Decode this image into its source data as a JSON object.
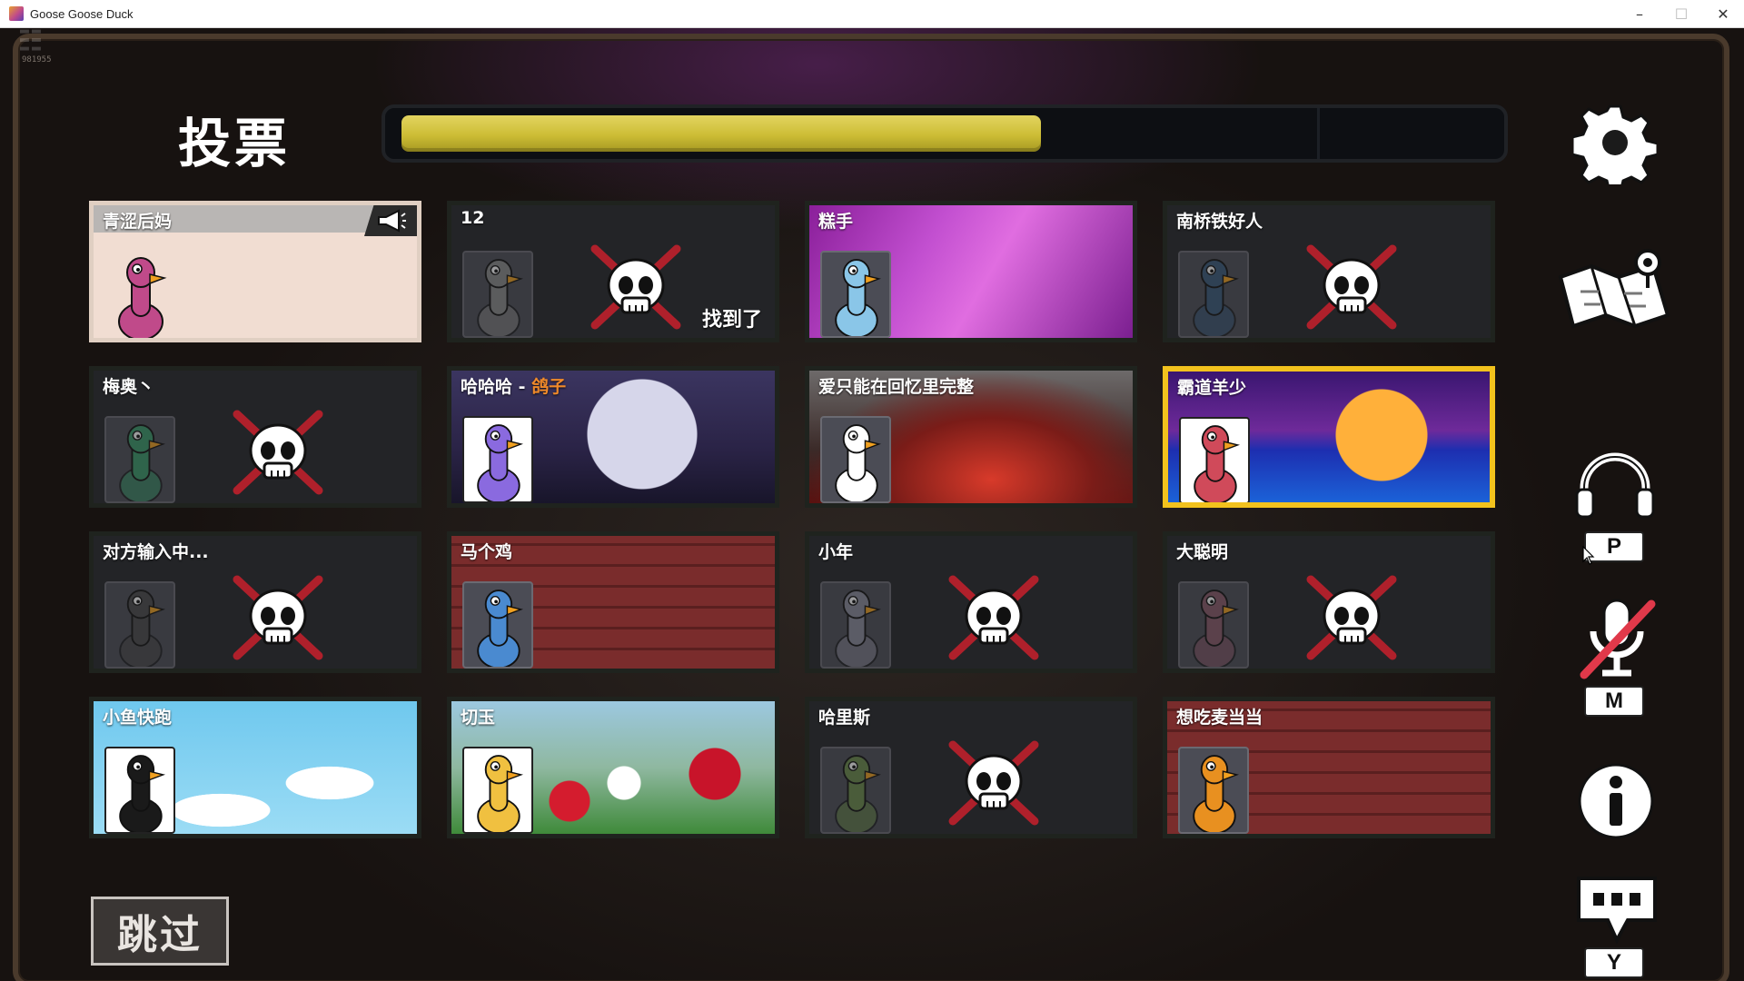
{
  "window": {
    "title": "Goose Goose Duck",
    "minimize": "–",
    "maximize": "☐",
    "close": "✕"
  },
  "watermark": {
    "id": "981955"
  },
  "header": {
    "title": "投票",
    "timer_remaining_fraction": 0.59
  },
  "players": [
    {
      "name": "青涩后妈",
      "state": "self"
    },
    {
      "name": "12",
      "state": "dead",
      "status_text": "找到了"
    },
    {
      "name": "糕手",
      "state": "alive"
    },
    {
      "name": "南桥铁好人",
      "state": "dead"
    },
    {
      "name": "梅奥丶",
      "state": "dead"
    },
    {
      "name": "哈哈哈 - ",
      "tag": "鸽子",
      "state": "alive"
    },
    {
      "name": "爱只能在回忆里完整",
      "state": "alive"
    },
    {
      "name": "霸道羊少",
      "state": "alive",
      "selected": true
    },
    {
      "name": "对方输入中...",
      "state": "dead"
    },
    {
      "name": "马个鸡",
      "state": "alive"
    },
    {
      "name": "小年",
      "state": "dead"
    },
    {
      "name": "大聪明",
      "state": "dead"
    },
    {
      "name": "小鱼快跑",
      "state": "alive"
    },
    {
      "name": "切玉",
      "state": "alive"
    },
    {
      "name": "哈里斯",
      "state": "dead"
    },
    {
      "name": "想吃麦当当",
      "state": "alive"
    }
  ],
  "skip_button": {
    "label": "跳过"
  },
  "sidebar": {
    "settings_icon": "gear-icon",
    "map_icon": "map-icon",
    "voice_key": "P",
    "mic_key": "M",
    "info_icon": "info-icon",
    "chat_key": "Y"
  },
  "colors": {
    "timer_fill": "#d8c94a",
    "selected_border": "#f2c21d",
    "tag_orange": "#f08a2a"
  }
}
